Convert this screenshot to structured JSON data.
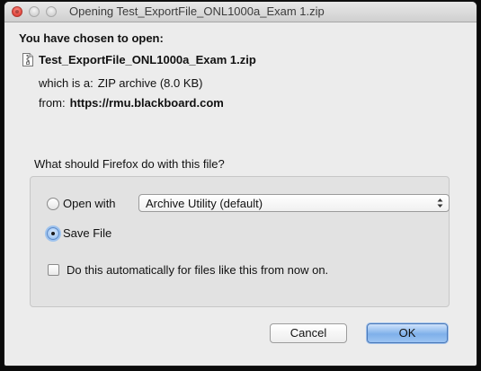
{
  "window": {
    "title": "Opening Test_ExportFile_ONL1000a_Exam 1.zip"
  },
  "dialog": {
    "heading": "You have chosen to open:",
    "file_icon": "document-zip-icon",
    "filename": "Test_ExportFile_ONL1000a_Exam 1.zip",
    "type_label": "which is a:",
    "type_value": "ZIP archive (8.0 KB)",
    "from_label": "from:",
    "from_value": "https://rmu.blackboard.com",
    "question": "What should Firefox do with this file?"
  },
  "options": {
    "open_with_label": "Open with",
    "open_with_selected": "Archive Utility (default)",
    "save_file_label": "Save File",
    "save_file_selected": true,
    "auto_label": "Do this automatically for files like this from now on.",
    "auto_checked": false
  },
  "buttons": {
    "cancel": "Cancel",
    "ok": "OK"
  },
  "colors": {
    "close_button": "#e0443b",
    "default_button": "#7fb0ea",
    "focus_ring": "#9ec3ee"
  }
}
